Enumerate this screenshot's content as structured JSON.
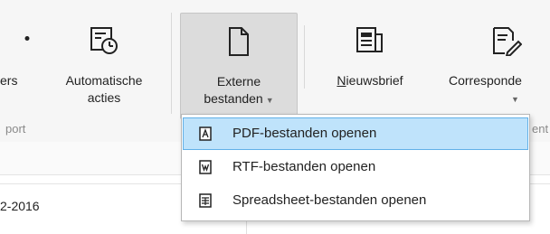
{
  "ribbon": {
    "partial_left_label": "ers",
    "automatische_acties": {
      "line1": "Automatische",
      "line2": "acties"
    },
    "externe_bestanden": {
      "line1": "Externe",
      "line2": "bestanden"
    },
    "nieuwsbrief": {
      "label_first": "N",
      "label_rest": "ieuwsbrief"
    },
    "correspondentie": {
      "label": "Corresponde"
    },
    "group_footer_left": "port",
    "group_footer_right": "ent"
  },
  "content": {
    "date_partial": "2-2016"
  },
  "dropdown": {
    "items": [
      {
        "label": "PDF-bestanden openen",
        "icon": "pdf-file-icon",
        "selected": true
      },
      {
        "label": "RTF-bestanden openen",
        "icon": "rtf-file-icon",
        "selected": false
      },
      {
        "label": "Spreadsheet-bestanden openen",
        "icon": "spreadsheet-file-icon",
        "selected": false
      }
    ]
  },
  "colors": {
    "ribbon_bg": "#f6f6f6",
    "active_button_bg": "#dcdcdc",
    "menu_selected_bg": "#bfe3fb",
    "menu_selected_border": "#61b0e8"
  }
}
